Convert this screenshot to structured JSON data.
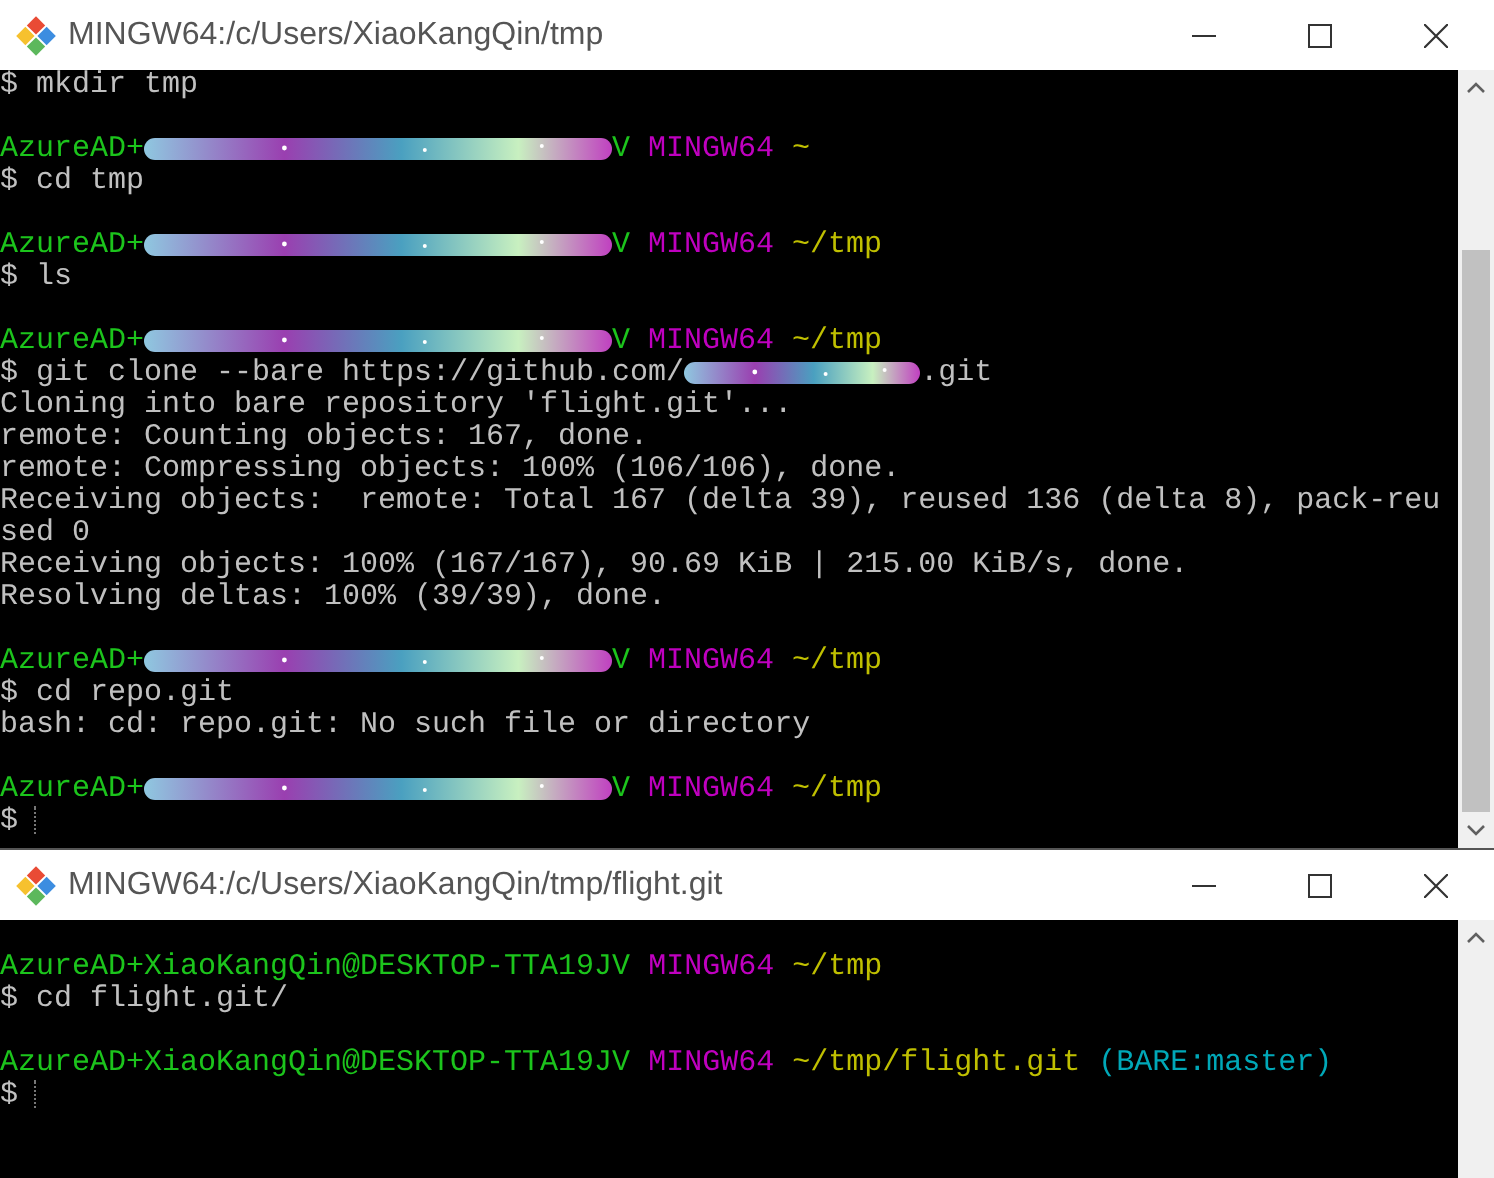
{
  "windows": [
    {
      "title": "MINGW64:/c/Users/XiaoKangQin/tmp",
      "lines": [
        {
          "kind": "text",
          "segments": [
            {
              "kind": "text",
              "text": "$ mkdir tmp",
              "color": "#c0c0c0"
            }
          ]
        },
        {
          "kind": "blank"
        },
        {
          "kind": "text",
          "segments": [
            {
              "kind": "text",
              "text": "AzureAD+",
              "color": "#1cc41c"
            },
            {
              "kind": "scribble"
            },
            {
              "kind": "text",
              "text": "V",
              "color": "#1cc41c"
            },
            {
              "kind": "text",
              "text": " MINGW64",
              "color": "#bf00bf"
            },
            {
              "kind": "text",
              "text": " ~",
              "color": "#bfbf00"
            }
          ]
        },
        {
          "kind": "text",
          "segments": [
            {
              "kind": "text",
              "text": "$ cd tmp",
              "color": "#c0c0c0"
            }
          ]
        },
        {
          "kind": "blank"
        },
        {
          "kind": "text",
          "segments": [
            {
              "kind": "text",
              "text": "AzureAD+",
              "color": "#1cc41c"
            },
            {
              "kind": "scribble"
            },
            {
              "kind": "text",
              "text": "V",
              "color": "#1cc41c"
            },
            {
              "kind": "text",
              "text": " MINGW64",
              "color": "#bf00bf"
            },
            {
              "kind": "text",
              "text": " ~/tmp",
              "color": "#bfbf00"
            }
          ]
        },
        {
          "kind": "text",
          "segments": [
            {
              "kind": "text",
              "text": "$ ls",
              "color": "#c0c0c0"
            }
          ]
        },
        {
          "kind": "blank"
        },
        {
          "kind": "text",
          "segments": [
            {
              "kind": "text",
              "text": "AzureAD+",
              "color": "#1cc41c"
            },
            {
              "kind": "scribble"
            },
            {
              "kind": "text",
              "text": "V",
              "color": "#1cc41c"
            },
            {
              "kind": "text",
              "text": " MINGW64",
              "color": "#bf00bf"
            },
            {
              "kind": "text",
              "text": " ~/tmp",
              "color": "#bfbf00"
            }
          ]
        },
        {
          "kind": "text",
          "segments": [
            {
              "kind": "text",
              "text": "$ git clone --bare https://github.com/",
              "color": "#c0c0c0"
            },
            {
              "kind": "scribble-short"
            },
            {
              "kind": "text",
              "text": ".git",
              "color": "#c0c0c0"
            }
          ]
        },
        {
          "kind": "text",
          "segments": [
            {
              "kind": "text",
              "text": "Cloning into bare repository 'flight.git'...",
              "color": "#c0c0c0"
            }
          ]
        },
        {
          "kind": "text",
          "segments": [
            {
              "kind": "text",
              "text": "remote: Counting objects: 167, done.",
              "color": "#c0c0c0"
            }
          ]
        },
        {
          "kind": "text",
          "segments": [
            {
              "kind": "text",
              "text": "remote: Compressing objects: 100% (106/106), done.",
              "color": "#c0c0c0"
            }
          ]
        },
        {
          "kind": "text",
          "segments": [
            {
              "kind": "text",
              "text": "Receiving objects:  remote: Total 167 (delta 39), reused 136 (delta 8), pack-reu",
              "color": "#c0c0c0"
            }
          ]
        },
        {
          "kind": "text",
          "segments": [
            {
              "kind": "text",
              "text": "sed 0",
              "color": "#c0c0c0"
            }
          ]
        },
        {
          "kind": "text",
          "segments": [
            {
              "kind": "text",
              "text": "Receiving objects: 100% (167/167), 90.69 KiB | 215.00 KiB/s, done.",
              "color": "#c0c0c0"
            }
          ]
        },
        {
          "kind": "text",
          "segments": [
            {
              "kind": "text",
              "text": "Resolving deltas: 100% (39/39), done.",
              "color": "#c0c0c0"
            }
          ]
        },
        {
          "kind": "blank"
        },
        {
          "kind": "text",
          "segments": [
            {
              "kind": "text",
              "text": "AzureAD+",
              "color": "#1cc41c"
            },
            {
              "kind": "scribble"
            },
            {
              "kind": "text",
              "text": "V",
              "color": "#1cc41c"
            },
            {
              "kind": "text",
              "text": " MINGW64",
              "color": "#bf00bf"
            },
            {
              "kind": "text",
              "text": " ~/tmp",
              "color": "#bfbf00"
            }
          ]
        },
        {
          "kind": "text",
          "segments": [
            {
              "kind": "text",
              "text": "$ cd repo.git",
              "color": "#c0c0c0"
            }
          ]
        },
        {
          "kind": "text",
          "segments": [
            {
              "kind": "text",
              "text": "bash: cd: repo.git: No such file or directory",
              "color": "#c0c0c0"
            }
          ]
        },
        {
          "kind": "blank"
        },
        {
          "kind": "text",
          "segments": [
            {
              "kind": "text",
              "text": "AzureAD+",
              "color": "#1cc41c"
            },
            {
              "kind": "scribble"
            },
            {
              "kind": "text",
              "text": "V",
              "color": "#1cc41c"
            },
            {
              "kind": "text",
              "text": " MINGW64",
              "color": "#bf00bf"
            },
            {
              "kind": "text",
              "text": " ~/tmp",
              "color": "#bfbf00"
            }
          ]
        },
        {
          "kind": "text",
          "segments": [
            {
              "kind": "text",
              "text": "$",
              "color": "#c0c0c0"
            },
            {
              "kind": "cursor"
            }
          ]
        }
      ]
    },
    {
      "title": "MINGW64:/c/Users/XiaoKangQin/tmp/flight.git",
      "lines": [
        {
          "kind": "blank"
        },
        {
          "kind": "text",
          "segments": [
            {
              "kind": "text",
              "text": "AzureAD+XiaoKangQin@DESKTOP-TTA19JV",
              "color": "#1cc41c"
            },
            {
              "kind": "text",
              "text": " MINGW64",
              "color": "#bf00bf"
            },
            {
              "kind": "text",
              "text": " ~/tmp",
              "color": "#bfbf00"
            }
          ]
        },
        {
          "kind": "text",
          "segments": [
            {
              "kind": "text",
              "text": "$ cd flight.git/",
              "color": "#c0c0c0"
            }
          ]
        },
        {
          "kind": "blank"
        },
        {
          "kind": "text",
          "segments": [
            {
              "kind": "text",
              "text": "AzureAD+XiaoKangQin@DESKTOP-TTA19JV",
              "color": "#1cc41c"
            },
            {
              "kind": "text",
              "text": " MINGW64",
              "color": "#bf00bf"
            },
            {
              "kind": "text",
              "text": " ~/tmp/flight.git",
              "color": "#bfbf00"
            },
            {
              "kind": "text",
              "text": " (BARE:master)",
              "color": "#00a8b8"
            }
          ]
        },
        {
          "kind": "text",
          "segments": [
            {
              "kind": "text",
              "text": "$",
              "color": "#c0c0c0"
            },
            {
              "kind": "cursor"
            }
          ]
        }
      ]
    }
  ]
}
